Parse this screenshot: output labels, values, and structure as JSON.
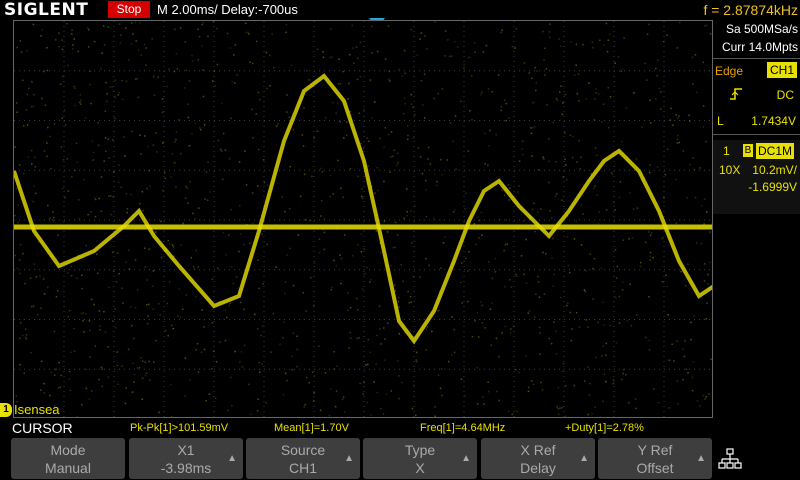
{
  "header": {
    "logo": "SIGLENT",
    "run_state": "Stop",
    "timebase": "M 2.00ms/ Delay:-700us",
    "frequency": "f = 2.87874kHz"
  },
  "side_panel": {
    "sample_rate": "Sa 500MSa/s",
    "memory": "Curr 14.0Mpts",
    "trigger": {
      "type": "Edge",
      "source": "CH1",
      "slope_icon": "rising-edge-icon",
      "coupling": "DC",
      "level_label": "L",
      "level": "1.7434V"
    },
    "channel": {
      "number": "1",
      "bw_flag": "B",
      "coupling": "DC1M",
      "probe": "10X",
      "scale": "10.2mV/",
      "offset": "-1.6999V"
    }
  },
  "channel_marker": {
    "number": "1",
    "label": "Isensea"
  },
  "measurements": {
    "menu_title": "CURSOR",
    "items": [
      "Pk-Pk[1]>101.59mV",
      "Mean[1]=1.70V",
      "Freq[1]=4.64MHz",
      "+Duty[1]=2.78%"
    ]
  },
  "softkeys": [
    {
      "title": "Mode",
      "value": "Manual"
    },
    {
      "title": "X1",
      "value": "-3.98ms"
    },
    {
      "title": "Source",
      "value": "CH1"
    },
    {
      "title": "Type",
      "value": "X"
    },
    {
      "title": "X Ref",
      "value": "Delay"
    },
    {
      "title": "Y Ref",
      "value": "Offset"
    }
  ],
  "colors": {
    "trace": "#e8e000",
    "stop": "#d40000",
    "trigger_marker": "#1ea7e8"
  }
}
